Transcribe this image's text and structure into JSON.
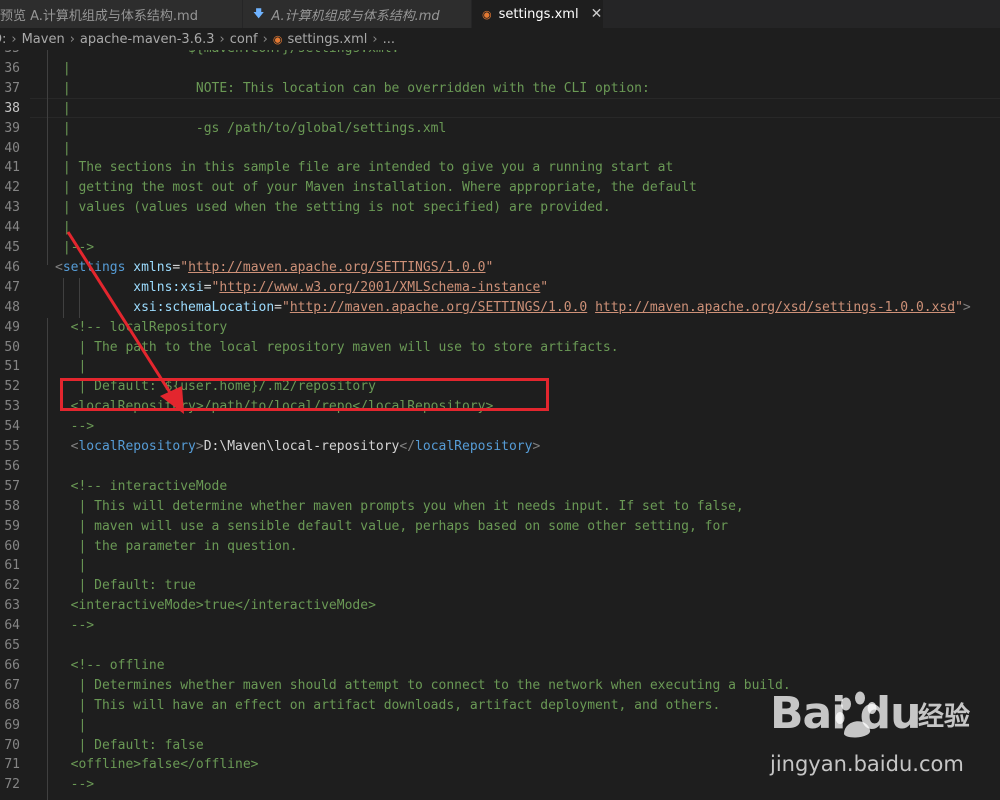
{
  "tabs": [
    {
      "label": "预览 A.计算机组成与体系结构.md"
    },
    {
      "label": "A.计算机组成与体系结构.md"
    },
    {
      "label": "settings.xml",
      "close": "✕"
    }
  ],
  "breadcrumb": {
    "items": [
      "D:",
      "Maven",
      "apache-maven-3.6.3",
      "conf",
      "settings.xml",
      "..."
    ]
  },
  "editor": {
    "current_line": "38",
    "lines": [
      {
        "n": "35",
        "segs": [
          {
            "t": "                 ${maven.conf}/settings.xml.",
            "c": "c"
          }
        ]
      },
      {
        "n": "36",
        "segs": [
          {
            "t": " |",
            "c": "c"
          }
        ]
      },
      {
        "n": "37",
        "segs": [
          {
            "t": " |                NOTE: This location can be overridden with the CLI option:",
            "c": "c"
          }
        ]
      },
      {
        "n": "38",
        "segs": [
          {
            "t": " |",
            "c": "c"
          }
        ]
      },
      {
        "n": "39",
        "segs": [
          {
            "t": " |                -gs /path/to/global/settings.xml",
            "c": "c"
          }
        ]
      },
      {
        "n": "40",
        "segs": [
          {
            "t": " |",
            "c": "c"
          }
        ]
      },
      {
        "n": "41",
        "segs": [
          {
            "t": " | The sections in this sample file are intended to give you a running start at",
            "c": "c"
          }
        ]
      },
      {
        "n": "42",
        "segs": [
          {
            "t": " | getting the most out of your Maven installation. Where appropriate, the default",
            "c": "c"
          }
        ]
      },
      {
        "n": "43",
        "segs": [
          {
            "t": " | values (values used when the setting is not specified) are provided.",
            "c": "c"
          }
        ]
      },
      {
        "n": "44",
        "segs": [
          {
            "t": " |",
            "c": "c"
          }
        ]
      },
      {
        "n": "45",
        "segs": [
          {
            "t": " |-->",
            "c": "c"
          }
        ]
      },
      {
        "n": "46",
        "segs": [
          {
            "t": "<",
            "c": "br"
          },
          {
            "t": "settings",
            "c": "tg"
          },
          {
            "t": " xmlns",
            "c": "at"
          },
          {
            "t": "=",
            "c": "tx"
          },
          {
            "t": "\"",
            "c": "st"
          },
          {
            "t": "http://maven.apache.org/SETTINGS/1.0.0",
            "c": "st u"
          },
          {
            "t": "\"",
            "c": "st"
          }
        ]
      },
      {
        "n": "47",
        "segs": [
          {
            "t": "          xmlns:xsi",
            "c": "at"
          },
          {
            "t": "=",
            "c": "tx"
          },
          {
            "t": "\"",
            "c": "st"
          },
          {
            "t": "http://www.w3.org/2001/XMLSchema-instance",
            "c": "st u"
          },
          {
            "t": "\"",
            "c": "st"
          }
        ]
      },
      {
        "n": "48",
        "segs": [
          {
            "t": "          xsi:schemaLocation",
            "c": "at"
          },
          {
            "t": "=",
            "c": "tx"
          },
          {
            "t": "\"",
            "c": "st"
          },
          {
            "t": "http://maven.apache.org/SETTINGS/1.0.0",
            "c": "st u"
          },
          {
            "t": " ",
            "c": "st"
          },
          {
            "t": "http://maven.apache.org/xsd/settings-1.0.0.xsd",
            "c": "st u"
          },
          {
            "t": "\"",
            "c": "st"
          },
          {
            "t": ">",
            "c": "br"
          }
        ]
      },
      {
        "n": "49",
        "segs": [
          {
            "t": "  <!-- localRepository",
            "c": "c"
          }
        ]
      },
      {
        "n": "50",
        "segs": [
          {
            "t": "   | The path to the local repository maven will use to store artifacts.",
            "c": "c"
          }
        ]
      },
      {
        "n": "51",
        "segs": [
          {
            "t": "   |",
            "c": "c"
          }
        ]
      },
      {
        "n": "52",
        "segs": [
          {
            "t": "   | Default: ${user.home}/.m2/repository",
            "c": "c"
          }
        ]
      },
      {
        "n": "53",
        "segs": [
          {
            "t": "  <localRepository>/path/to/local/repo</localRepository>",
            "c": "c"
          }
        ]
      },
      {
        "n": "54",
        "segs": [
          {
            "t": "  -->",
            "c": "c"
          }
        ]
      },
      {
        "n": "55",
        "segs": [
          {
            "t": "  ",
            "c": "tx"
          },
          {
            "t": "<",
            "c": "br"
          },
          {
            "t": "localRepository",
            "c": "tg"
          },
          {
            "t": ">",
            "c": "br"
          },
          {
            "t": "D:\\Maven\\local-repository",
            "c": "tx"
          },
          {
            "t": "</",
            "c": "br"
          },
          {
            "t": "localRepository",
            "c": "tg"
          },
          {
            "t": ">",
            "c": "br"
          }
        ]
      },
      {
        "n": "56",
        "segs": [
          {
            "t": "",
            "c": "tx"
          }
        ]
      },
      {
        "n": "57",
        "segs": [
          {
            "t": "  <!-- interactiveMode",
            "c": "c"
          }
        ]
      },
      {
        "n": "58",
        "segs": [
          {
            "t": "   | This will determine whether maven prompts you when it needs input. If set to false,",
            "c": "c"
          }
        ]
      },
      {
        "n": "59",
        "segs": [
          {
            "t": "   | maven will use a sensible default value, perhaps based on some other setting, for",
            "c": "c"
          }
        ]
      },
      {
        "n": "60",
        "segs": [
          {
            "t": "   | the parameter in question.",
            "c": "c"
          }
        ]
      },
      {
        "n": "61",
        "segs": [
          {
            "t": "   |",
            "c": "c"
          }
        ]
      },
      {
        "n": "62",
        "segs": [
          {
            "t": "   | Default: true",
            "c": "c"
          }
        ]
      },
      {
        "n": "63",
        "segs": [
          {
            "t": "  <interactiveMode>true</interactiveMode>",
            "c": "c"
          }
        ]
      },
      {
        "n": "64",
        "segs": [
          {
            "t": "  -->",
            "c": "c"
          }
        ]
      },
      {
        "n": "65",
        "segs": [
          {
            "t": "",
            "c": "tx"
          }
        ]
      },
      {
        "n": "66",
        "segs": [
          {
            "t": "  <!-- offline",
            "c": "c"
          }
        ]
      },
      {
        "n": "67",
        "segs": [
          {
            "t": "   | Determines whether maven should attempt to connect to the network when executing a build.",
            "c": "c"
          }
        ]
      },
      {
        "n": "68",
        "segs": [
          {
            "t": "   | This will have an effect on artifact downloads, artifact deployment, and others.",
            "c": "c"
          }
        ]
      },
      {
        "n": "69",
        "segs": [
          {
            "t": "   |",
            "c": "c"
          }
        ]
      },
      {
        "n": "70",
        "segs": [
          {
            "t": "   | Default: false",
            "c": "c"
          }
        ]
      },
      {
        "n": "71",
        "segs": [
          {
            "t": "  <offline>false</offline>",
            "c": "c"
          }
        ]
      },
      {
        "n": "72",
        "segs": [
          {
            "t": "  -->",
            "c": "c"
          }
        ]
      }
    ]
  },
  "watermark": {
    "logo": "Bai du",
    "cn": "经验",
    "url": "jingyan.baidu.com"
  },
  "colors": {
    "comment": "#6a9955",
    "tag": "#569cd6",
    "attribute": "#9cdcfe",
    "string": "#ce9178",
    "annotation_red": "#e3262e"
  }
}
